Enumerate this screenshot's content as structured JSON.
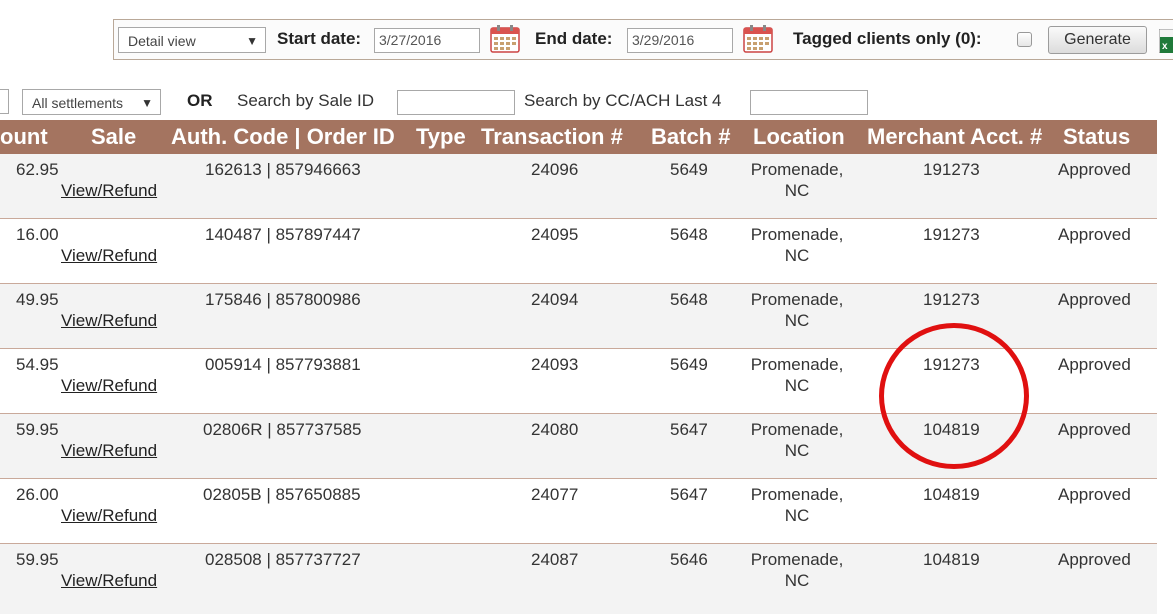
{
  "filters": {
    "view_select": "Detail view",
    "start_date_label": "Start date:",
    "start_date_value": "3/27/2016",
    "end_date_label": "End date:",
    "end_date_value": "3/29/2016",
    "tagged_label": "Tagged clients only (0):",
    "generate_label": "Generate",
    "tagged_checked": false
  },
  "search": {
    "settlements_select": "All settlements",
    "or_label": "OR",
    "sale_id_label": "Search by Sale ID",
    "sale_id_value": "",
    "cc_label": "Search by CC/ACH Last 4",
    "cc_value": ""
  },
  "table": {
    "headers": [
      "ount",
      "Sale",
      "Auth. Code | Order ID",
      "Type",
      "Transaction #",
      "Batch #",
      "Location",
      "Merchant Acct. #",
      "Status"
    ],
    "link_label": "View/Refund",
    "rows": [
      {
        "amount": "62.95",
        "auth_order": "162613 | 857946663",
        "type": "",
        "transaction": "24096",
        "batch": "5649",
        "location": "Promenade, NC",
        "merchant": "191273",
        "status": "Approved"
      },
      {
        "amount": "16.00",
        "auth_order": "140487 | 857897447",
        "type": "",
        "transaction": "24095",
        "batch": "5648",
        "location": "Promenade, NC",
        "merchant": "191273",
        "status": "Approved"
      },
      {
        "amount": "49.95",
        "auth_order": "175846 | 857800986",
        "type": "",
        "transaction": "24094",
        "batch": "5648",
        "location": "Promenade, NC",
        "merchant": "191273",
        "status": "Approved"
      },
      {
        "amount": "54.95",
        "auth_order": "005914 | 857793881",
        "type": "",
        "transaction": "24093",
        "batch": "5649",
        "location": "Promenade, NC",
        "merchant": "191273",
        "status": "Approved"
      },
      {
        "amount": "59.95",
        "auth_order": "02806R | 857737585",
        "type": "",
        "transaction": "24080",
        "batch": "5647",
        "location": "Promenade, NC",
        "merchant": "104819",
        "status": "Approved"
      },
      {
        "amount": "26.00",
        "auth_order": "02805B | 857650885",
        "type": "",
        "transaction": "24077",
        "batch": "5647",
        "location": "Promenade, NC",
        "merchant": "104819",
        "status": "Approved"
      },
      {
        "amount": "59.95",
        "auth_order": "028508 | 857737727",
        "type": "",
        "transaction": "24087",
        "batch": "5646",
        "location": "Promenade, NC",
        "merchant": "104819",
        "status": "Approved"
      }
    ]
  },
  "colors": {
    "header_bg": "#a47460",
    "highlight_circle": "#e01010",
    "row_border": "#c9a99a"
  },
  "icons": [
    "calendar-icon",
    "calendar-icon",
    "excel-export-icon",
    "dropdown-arrow-icon"
  ]
}
